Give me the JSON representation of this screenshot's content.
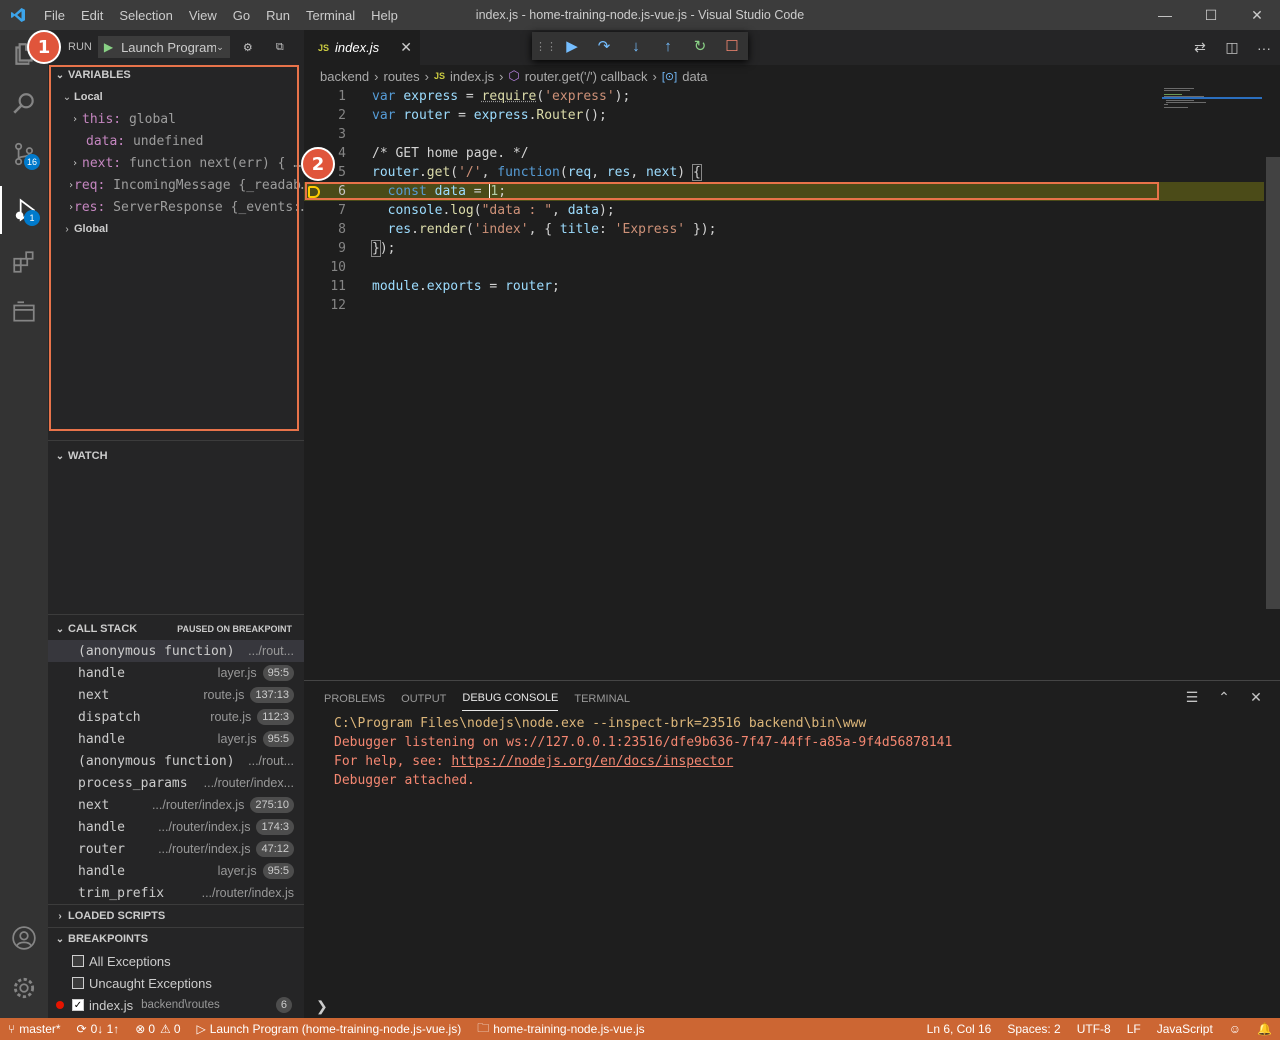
{
  "window": {
    "title": "index.js - home-training-node.js-vue.js - Visual Studio Code",
    "menu": [
      "File",
      "Edit",
      "Selection",
      "View",
      "Go",
      "Run",
      "Terminal",
      "Help"
    ],
    "controls": {
      "minimize": "—",
      "maximize": "☐",
      "close": "✕"
    }
  },
  "activity_bar": {
    "source_control_badge": "16",
    "debug_badge": "1"
  },
  "sidebar": {
    "run_label": "RUN",
    "config_name": "Launch Program",
    "variables": {
      "header": "VARIABLES",
      "local_label": "Local",
      "items": [
        {
          "name": "this:",
          "value": "global"
        },
        {
          "name": "data:",
          "value": "undefined"
        },
        {
          "name": "next:",
          "value": "function next(err) { …"
        },
        {
          "name": "req:",
          "value": "IncomingMessage {_readab…"
        },
        {
          "name": "res:",
          "value": "ServerResponse {_events:…"
        }
      ],
      "global_label": "Global"
    },
    "watch": {
      "header": "WATCH"
    },
    "call_stack": {
      "header": "CALL STACK",
      "status": "PAUSED ON BREAKPOINT",
      "frames": [
        {
          "fn": "(anonymous function)",
          "src": ".../rout...",
          "pos": ""
        },
        {
          "fn": "handle",
          "src": "layer.js",
          "pos": "95:5"
        },
        {
          "fn": "next",
          "src": "route.js",
          "pos": "137:13"
        },
        {
          "fn": "dispatch",
          "src": "route.js",
          "pos": "112:3"
        },
        {
          "fn": "handle",
          "src": "layer.js",
          "pos": "95:5"
        },
        {
          "fn": "(anonymous function)",
          "src": ".../rout...",
          "pos": ""
        },
        {
          "fn": "process_params",
          "src": ".../router/index...",
          "pos": ""
        },
        {
          "fn": "next",
          "src": ".../router/index.js",
          "pos": "275:10"
        },
        {
          "fn": "handle",
          "src": ".../router/index.js",
          "pos": "174:3"
        },
        {
          "fn": "router",
          "src": ".../router/index.js",
          "pos": "47:12"
        },
        {
          "fn": "handle",
          "src": "layer.js",
          "pos": "95:5"
        },
        {
          "fn": "trim_prefix",
          "src": ".../router/index.js",
          "pos": ""
        }
      ]
    },
    "loaded_scripts": {
      "header": "LOADED SCRIPTS"
    },
    "breakpoints": {
      "header": "BREAKPOINTS",
      "items": [
        {
          "label": "All Exceptions",
          "checked": false
        },
        {
          "label": "Uncaught Exceptions",
          "checked": false
        },
        {
          "label": "index.js",
          "path": "backend\\routes",
          "count": "6",
          "checked": true
        }
      ]
    }
  },
  "editor": {
    "tab": {
      "icon": "JS",
      "name": "index.js"
    },
    "breadcrumb": [
      "backend",
      "routes",
      "index.js",
      "router.get('/') callback",
      "data"
    ],
    "current_line": 6,
    "lines": [
      {
        "n": "1"
      },
      {
        "n": "2"
      },
      {
        "n": "3"
      },
      {
        "n": "4"
      },
      {
        "n": "5"
      },
      {
        "n": "6"
      },
      {
        "n": "7"
      },
      {
        "n": "8"
      },
      {
        "n": "9"
      },
      {
        "n": "10"
      },
      {
        "n": "11"
      },
      {
        "n": "12"
      }
    ]
  },
  "panel": {
    "tabs": [
      "PROBLEMS",
      "OUTPUT",
      "DEBUG CONSOLE",
      "TERMINAL"
    ],
    "active_tab": "DEBUG CONSOLE",
    "console": [
      "C:\\Program Files\\nodejs\\node.exe --inspect-brk=23516 backend\\bin\\www",
      "Debugger listening on ws://127.0.0.1:23516/dfe9b636-7f47-44ff-a85a-9f4d56878141",
      "For help, see: ",
      "https://nodejs.org/en/docs/inspector",
      "Debugger attached."
    ],
    "prompt": "❯"
  },
  "status_bar": {
    "branch": "master*",
    "sync": "0↓ 1↑",
    "errors": "0",
    "warnings": "0",
    "launch": "Launch Program (home-training-node.js-vue.js)",
    "folder": "home-training-node.js-vue.js",
    "position": "Ln 6, Col 16",
    "spaces": "Spaces: 2",
    "encoding": "UTF-8",
    "eol": "LF",
    "language": "JavaScript",
    "color": "#cc6633"
  },
  "annotations": [
    "1",
    "2"
  ]
}
